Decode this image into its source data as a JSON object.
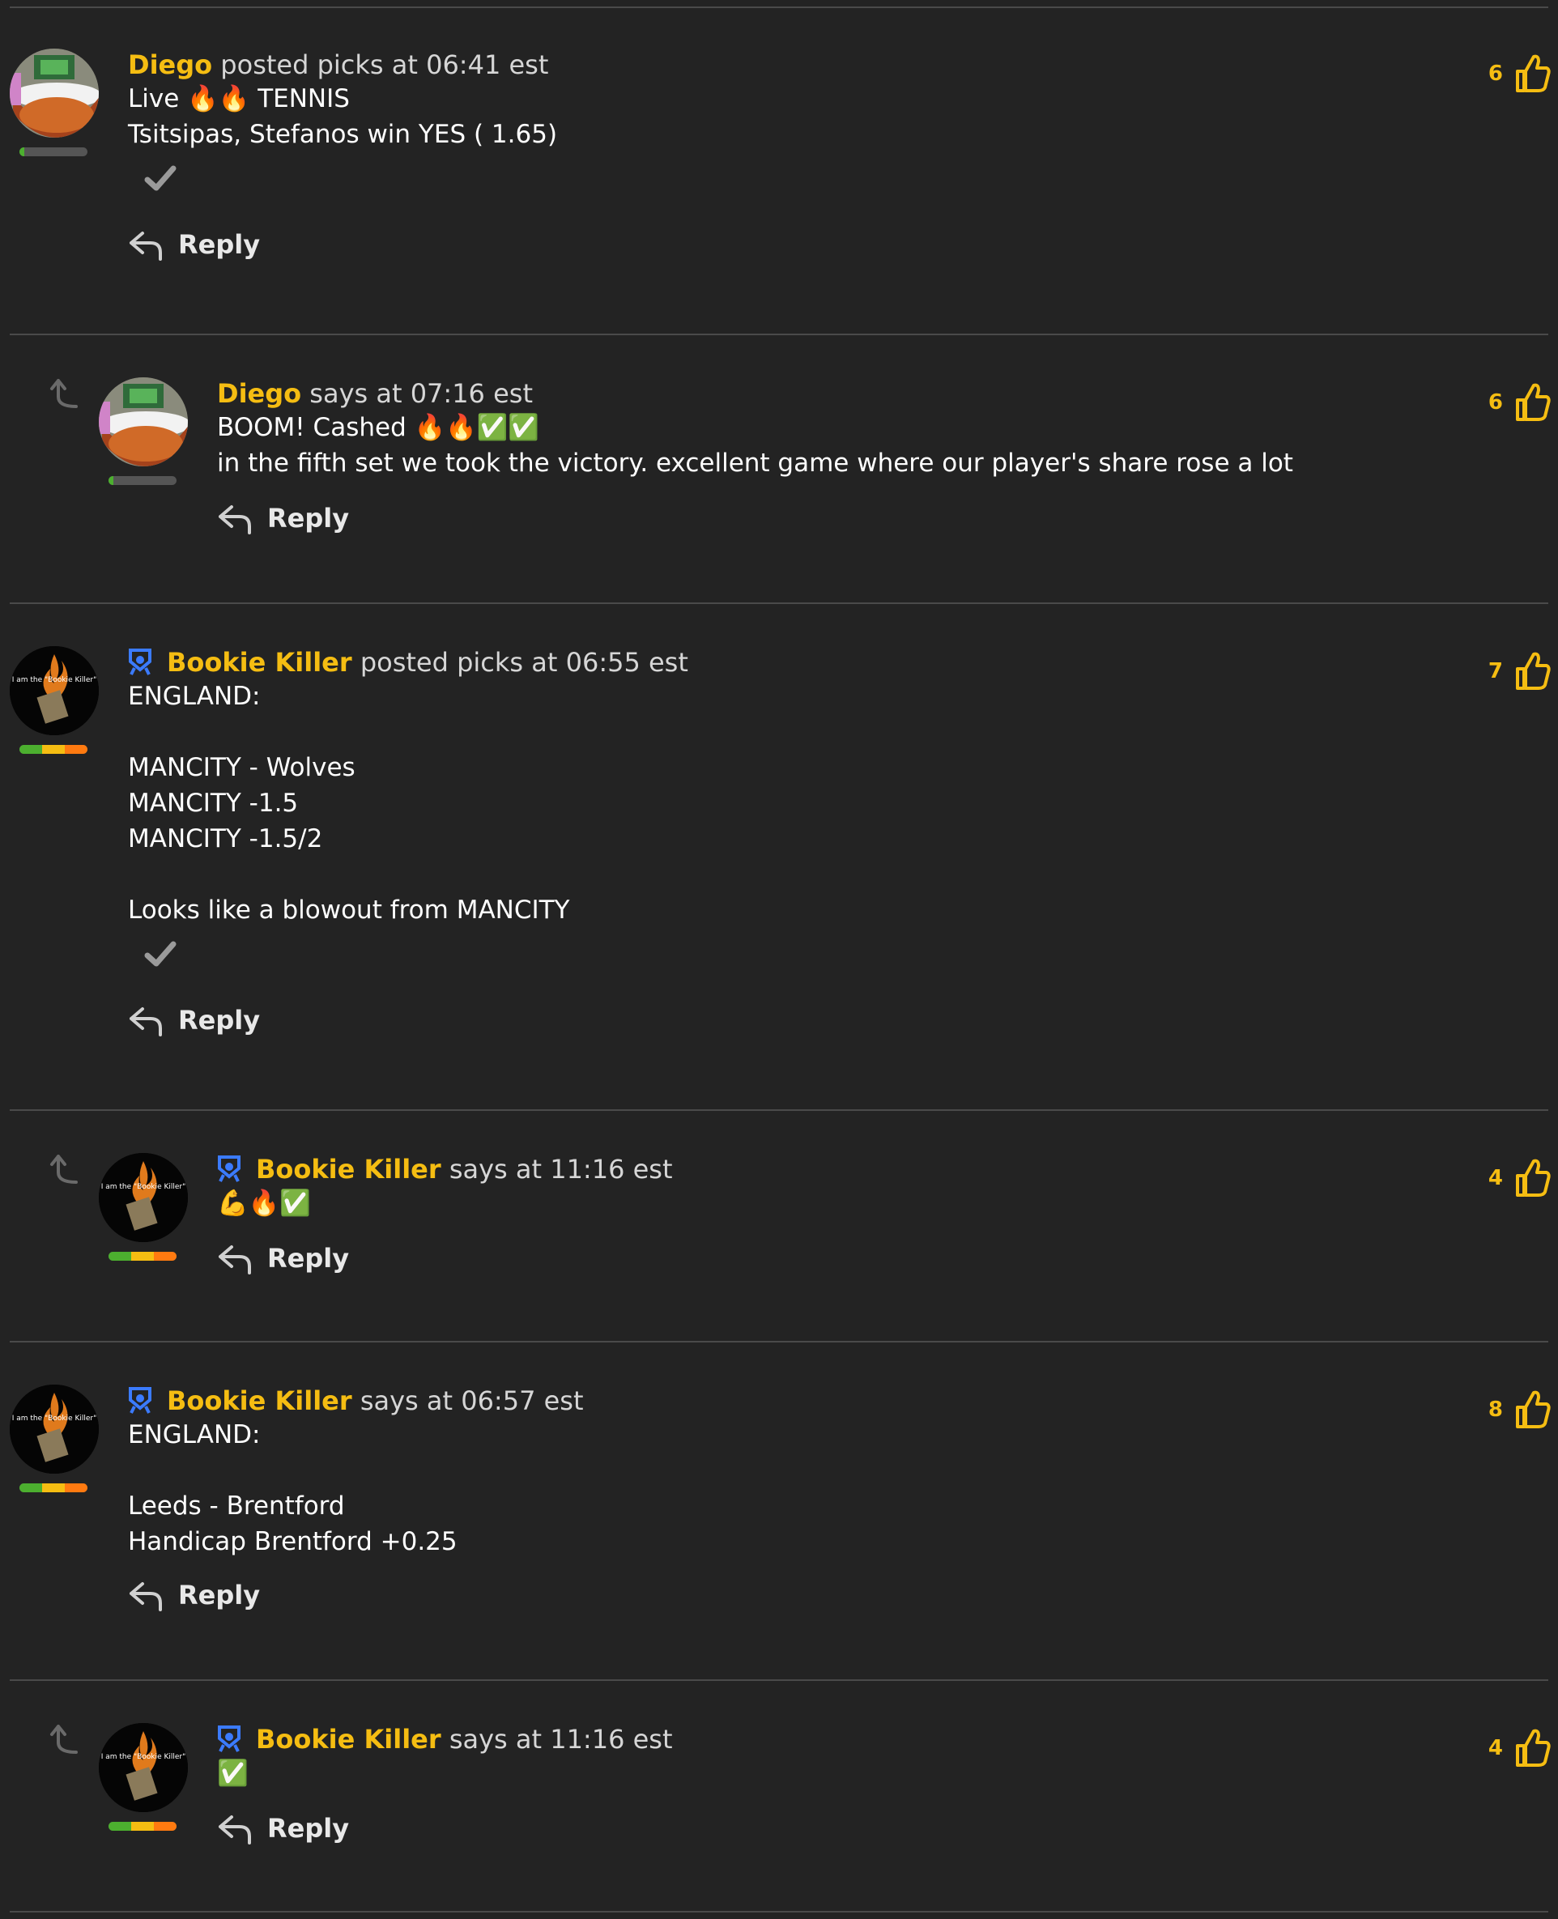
{
  "colors": {
    "accent": "#f5bd12",
    "background": "#232323",
    "separator": "#4a4a4a",
    "badge": "#3b7bff"
  },
  "posts": [
    {
      "username": "Diego",
      "meta": "posted picks at 06:41 est",
      "lines": [
        "Live 🔥🔥 TENNIS",
        "Tsitsipas, Stefanos win YES ( 1.65)"
      ],
      "reply_label": "Reply",
      "likes": "6",
      "rank_icon": "rank-bar-low",
      "avatar_icon": "tennis-scene-avatar"
    },
    {
      "username": "Diego",
      "meta": "says at 07:16 est",
      "lines": [
        "BOOM! Cashed 🔥🔥✅✅",
        "in the fifth set we took the victory. excellent game where our player's share rose a lot"
      ],
      "reply_label": "Reply",
      "likes": "6"
    },
    {
      "username": "Bookie Killer",
      "meta": "posted picks at 06:55 est",
      "lines": [
        "ENGLAND:",
        "",
        "MANCITY - Wolves",
        "MANCITY -1.5",
        "MANCITY -1.5/2",
        "",
        "Looks like a blowout from MANCITY"
      ],
      "reply_label": "Reply",
      "likes": "7",
      "avatar_caption": "I am the \"Bookie Killer\""
    },
    {
      "username": "Bookie Killer",
      "meta": "says at 11:16 est",
      "lines": [
        "💪🔥✅"
      ],
      "reply_label": "Reply",
      "likes": "4",
      "avatar_caption": "I am the \"Bookie Killer\""
    },
    {
      "username": "Bookie Killer",
      "meta": "says at 06:57 est",
      "lines": [
        "ENGLAND:",
        "",
        "Leeds - Brentford",
        "Handicap Brentford +0.25"
      ],
      "reply_label": "Reply",
      "likes": "8",
      "avatar_caption": "I am the \"Bookie Killer\""
    },
    {
      "username": "Bookie Killer",
      "meta": "says at 11:16 est",
      "lines": [
        "✅"
      ],
      "reply_label": "Reply",
      "likes": "4",
      "avatar_caption": "I am the \"Bookie Killer\""
    }
  ]
}
